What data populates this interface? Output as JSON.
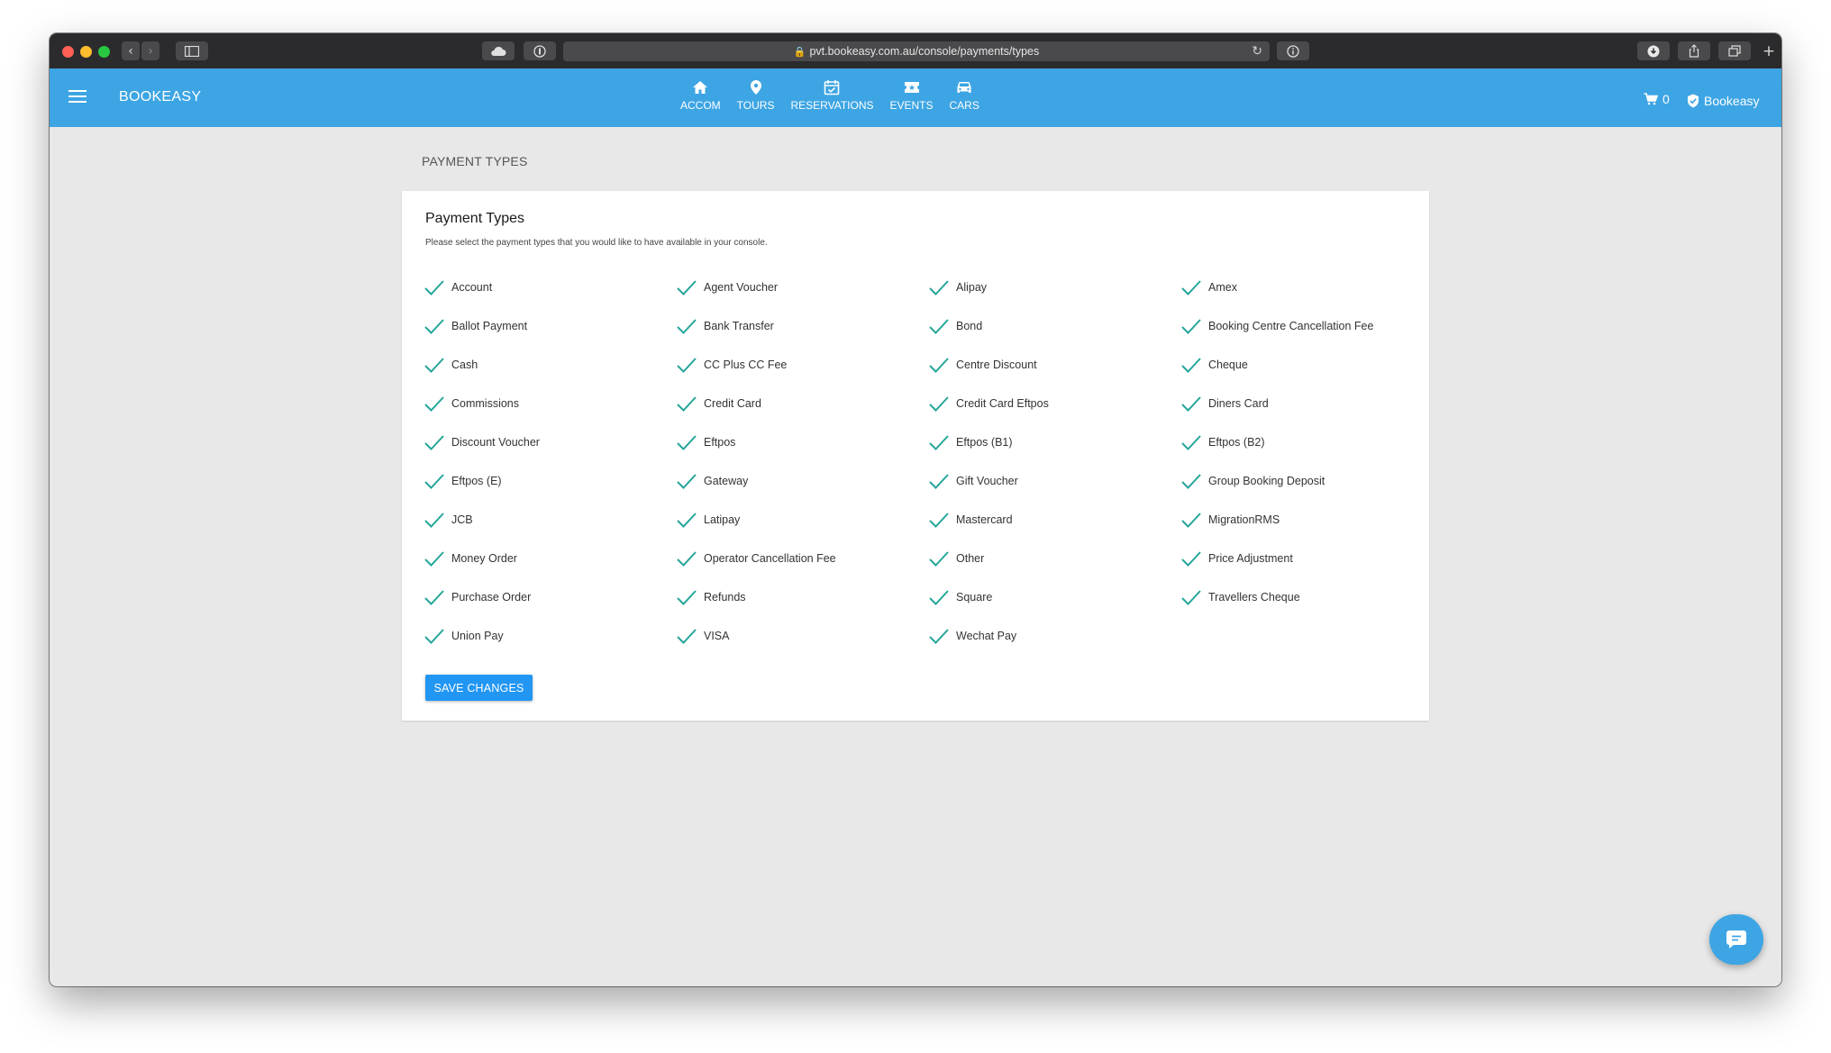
{
  "browser": {
    "url": "pvt.bookeasy.com.au/console/payments/types"
  },
  "header": {
    "brand": "BOOKEASY",
    "nav": [
      {
        "label": "ACCOM",
        "icon": "home-icon"
      },
      {
        "label": "TOURS",
        "icon": "map-pin-icon"
      },
      {
        "label": "RESERVATIONS",
        "icon": "calendar-check-icon"
      },
      {
        "label": "EVENTS",
        "icon": "ticket-icon"
      },
      {
        "label": "CARS",
        "icon": "car-icon"
      }
    ],
    "cart_count": "0",
    "account_name": "Bookeasy"
  },
  "breadcrumb": "PAYMENT TYPES",
  "card": {
    "title": "Payment Types",
    "subtitle": "Please select the payment types that you would like to have available in your console.",
    "save_label": "SAVE CHANGES"
  },
  "payment_types": [
    [
      "Account",
      "Agent Voucher",
      "Alipay",
      "Amex"
    ],
    [
      "Ballot Payment",
      "Bank Transfer",
      "Bond",
      "Booking Centre Cancellation Fee"
    ],
    [
      "Cash",
      "CC Plus CC Fee",
      "Centre Discount",
      "Cheque"
    ],
    [
      "Commissions",
      "Credit Card",
      "Credit Card Eftpos",
      "Diners Card"
    ],
    [
      "Discount Voucher",
      "Eftpos",
      "Eftpos (B1)",
      "Eftpos (B2)"
    ],
    [
      "Eftpos (E)",
      "Gateway",
      "Gift Voucher",
      "Group Booking Deposit"
    ],
    [
      "JCB",
      "Latipay",
      "Mastercard",
      "MigrationRMS"
    ],
    [
      "Money Order",
      "Operator Cancellation Fee",
      "Other",
      "Price Adjustment"
    ],
    [
      "Purchase Order",
      "Refunds",
      "Square",
      "Travellers Cheque"
    ],
    [
      "Union Pay",
      "VISA",
      "Wechat Pay"
    ]
  ],
  "colors": {
    "appbar": "#3da5e4",
    "check": "#26a69a",
    "button": "#2196f3"
  }
}
